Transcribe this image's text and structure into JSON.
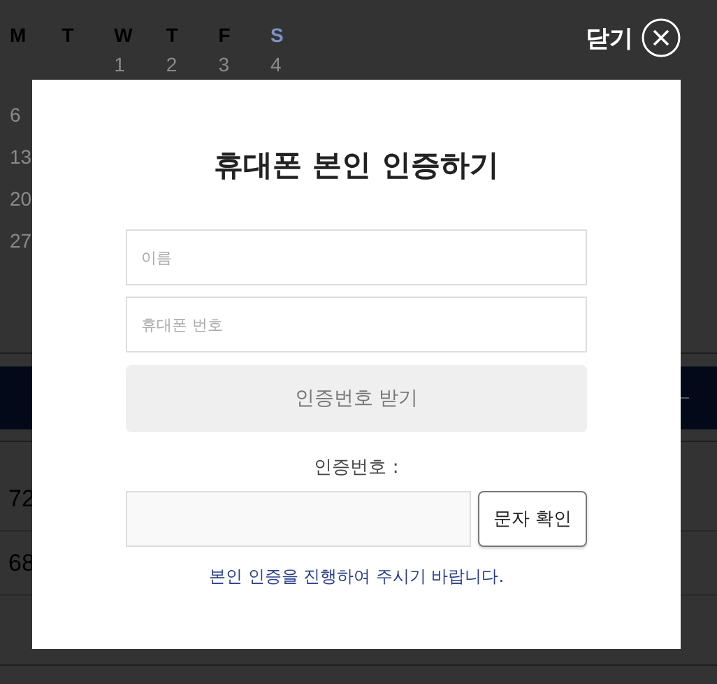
{
  "background": {
    "weekdays": [
      {
        "label": "M",
        "weekend": false
      },
      {
        "label": "T",
        "weekend": false
      },
      {
        "label": "W",
        "weekend": false
      },
      {
        "label": "T",
        "weekend": false
      },
      {
        "label": "F",
        "weekend": false
      },
      {
        "label": "S",
        "weekend": true
      }
    ],
    "date_rows": [
      [
        "",
        "",
        "1",
        "2",
        "3",
        "4"
      ],
      [
        "6"
      ],
      [
        "13"
      ],
      [
        "20"
      ],
      [
        "27"
      ]
    ],
    "table_cells": [
      "72",
      "68"
    ]
  },
  "modal": {
    "close_label": "닫기",
    "title": "휴대폰 본인 인증하기",
    "name_field": {
      "placeholder": "이름"
    },
    "phone_field": {
      "placeholder": "휴대폰 번호"
    },
    "request_button": "인증번호 받기",
    "code_label": "인증번호 :",
    "verify_button": "문자 확인",
    "notice": "본인 인증을 진행하여 주시기 바랍니다."
  }
}
